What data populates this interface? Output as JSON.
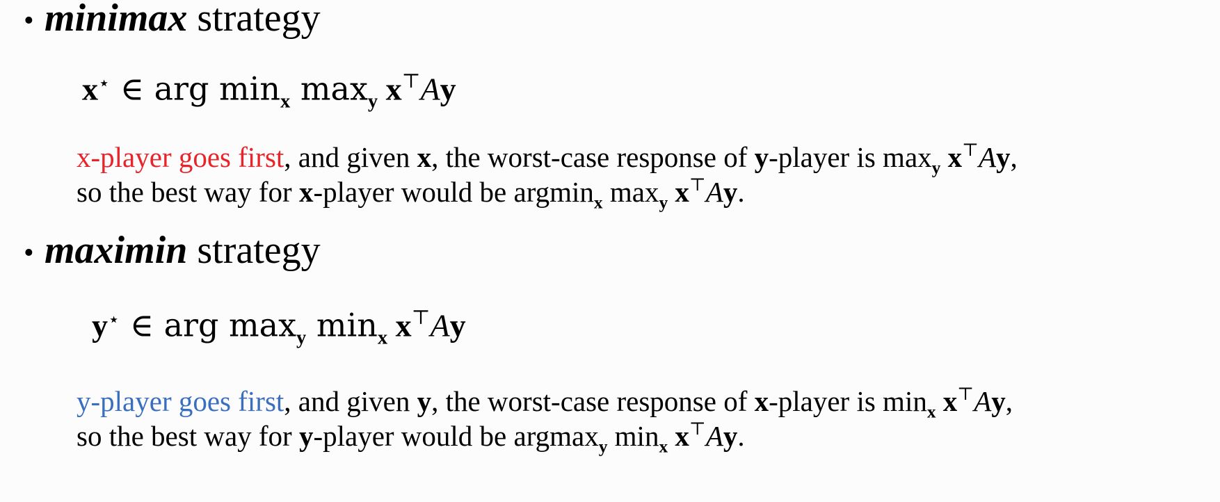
{
  "colors": {
    "red": "#e8242a",
    "blue": "#3a6fbf"
  },
  "section1": {
    "bullet": "•",
    "title_em": "minimax",
    "title_rest": " strategy",
    "eq_lhs": "x",
    "eq_star": "⋆",
    "eq_in": " ∈ arg min",
    "eq_sub1": "x",
    "eq_max": " max",
    "eq_sub2": "y",
    "eq_x": " x",
    "eq_T": "⊤",
    "eq_A": "A",
    "eq_y": "y",
    "p1_highlight": "x-player goes first",
    "p1_a": ", and given ",
    "p1_var1": "x",
    "p1_b": ", the worst-case response of ",
    "p1_var2": "y",
    "p1_c": "-player is max",
    "p1_sub": "y",
    "p1_x": " x",
    "p1_T": "⊤",
    "p1_A": "A",
    "p1_y": "y",
    "p1_end": ",",
    "p2_a": "so the best way for ",
    "p2_var": "x",
    "p2_b": "-player would be argmin",
    "p2_sub1": "x",
    "p2_max": " max",
    "p2_sub2": "y",
    "p2_x": " x",
    "p2_T": "⊤",
    "p2_A": "A",
    "p2_y": "y",
    "p2_end": "."
  },
  "section2": {
    "bullet": "•",
    "title_em": "maximin",
    "title_rest": " strategy",
    "eq_lhs": "y",
    "eq_star": "⋆",
    "eq_in": " ∈ arg max",
    "eq_sub1": "y",
    "eq_min": " min",
    "eq_sub2": "x",
    "eq_x": " x",
    "eq_T": "⊤",
    "eq_A": "A",
    "eq_y": "y",
    "p1_highlight": "y-player goes first",
    "p1_a": ", and given ",
    "p1_var1": "y",
    "p1_b": ", the worst-case response of ",
    "p1_var2": "x",
    "p1_c": "-player is min",
    "p1_sub": "x",
    "p1_x": " x",
    "p1_T": "⊤",
    "p1_A": "A",
    "p1_y": "y",
    "p1_end": ",",
    "p2_a": "so the best way for ",
    "p2_var": "y",
    "p2_b": "-player would be argmax",
    "p2_sub1": "y",
    "p2_min": " min",
    "p2_sub2": "x",
    "p2_x": " x",
    "p2_T": "⊤",
    "p2_A": "A",
    "p2_y": "y",
    "p2_end": "."
  }
}
